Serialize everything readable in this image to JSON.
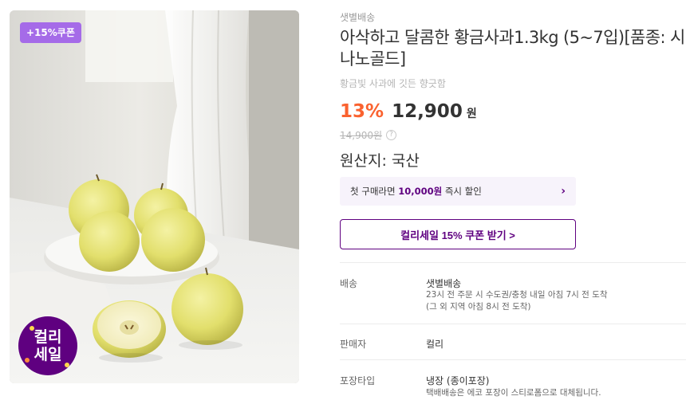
{
  "image": {
    "coupon_badge": "+15%쿠폰",
    "sale_badge_line1": "컬리",
    "sale_badge_line2": "세일",
    "alt": "황금사과"
  },
  "product": {
    "delivery_tag": "샛별배송",
    "title": "아삭하고 달콤한 황금사과1.3kg (5~7입)[품종: 시나노골드]",
    "subtitle": "황금빛 사과에 깃든 향긋함",
    "discount": "13%",
    "price": "12,900",
    "currency": "원",
    "original_price": "14,900원",
    "help_icon": "?",
    "origin": "원산지: 국산"
  },
  "promo": {
    "first_buy_prefix": "첫 구매라면 ",
    "first_buy_amount": "10,000원",
    "first_buy_suffix": " 즉시 할인",
    "chevron": "›",
    "coupon_button": "컬리세일 15% 쿠폰 받기 >"
  },
  "specs": [
    {
      "label": "배송",
      "value": "샛별배송",
      "sub1": "23시 전 주문 시 수도권/충청 내일 아침 7시 전 도착",
      "sub2": "(그 외 지역 아침 8시 전 도착)"
    },
    {
      "label": "판매자",
      "value": "컬리"
    },
    {
      "label": "포장타입",
      "value": "냉장 (종이포장)",
      "sub1": "택배배송은 에코 포장이 스티로폼으로 대체됩니다."
    }
  ],
  "colors": {
    "kurly_purple": "#5f0080",
    "coupon_badge": "#a56be8",
    "discount_orange": "#fa622f"
  }
}
